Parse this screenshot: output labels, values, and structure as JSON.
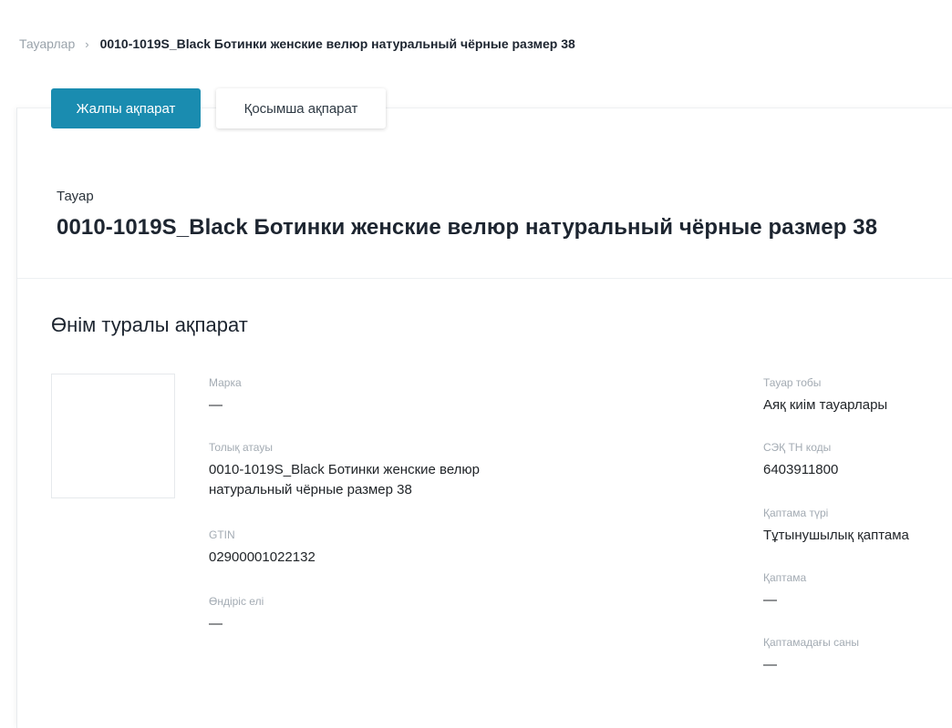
{
  "breadcrumb": {
    "parent": "Тауарлар",
    "separator": "›",
    "current": "0010-1019S_Black Ботинки женские велюр натуральный чёрные размер 38"
  },
  "tabs": {
    "general": "Жалпы ақпарат",
    "additional": "Қосымша ақпарат"
  },
  "product": {
    "label": "Тауар",
    "title": "0010-1019S_Black Ботинки женские велюр натуральный чёрные размер 38"
  },
  "info": {
    "section_title": "Өнім туралы ақпарат",
    "left": {
      "brand_label": "Марка",
      "brand_value": "—",
      "full_name_label": "Толық атауы",
      "full_name_value": "0010-1019S_Black Ботинки женские велюр натуральный чёрные размер 38",
      "gtin_label": "GTIN",
      "gtin_value": "02900001022132",
      "country_label": "Өндіріс елі",
      "country_value": "—"
    },
    "right": {
      "group_label": "Тауар тобы",
      "group_value": "Аяқ киім тауарлары",
      "tnved_label": "СЭҚ ТН коды",
      "tnved_value": "6403911800",
      "package_type_label": "Қаптама түрі",
      "package_type_value": "Тұтынушылық қаптама",
      "package_label": "Қаптама",
      "package_value": "—",
      "package_qty_label": "Қаптамадағы саны",
      "package_qty_value": "—"
    }
  },
  "colors": {
    "accent": "#1a8cb0",
    "muted": "#a3abb3"
  }
}
